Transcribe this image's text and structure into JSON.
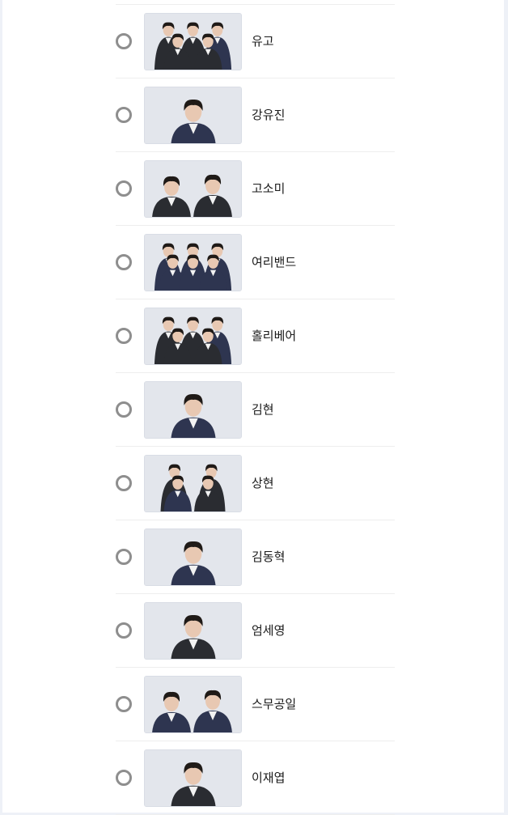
{
  "vote": {
    "options": [
      {
        "name": "유고",
        "photo": "group-photo-icon",
        "people": 5
      },
      {
        "name": "강유진",
        "photo": "person-photo-icon",
        "people": 1
      },
      {
        "name": "고소미",
        "photo": "duo-photo-icon",
        "people": 2
      },
      {
        "name": "여리밴드",
        "photo": "group-photo-icon",
        "people": 6
      },
      {
        "name": "홀리베어",
        "photo": "group-photo-icon",
        "people": 5
      },
      {
        "name": "김현",
        "photo": "person-photo-icon",
        "people": 1
      },
      {
        "name": "상현",
        "photo": "group-photo-icon",
        "people": 4
      },
      {
        "name": "김동혁",
        "photo": "person-photo-icon",
        "people": 1
      },
      {
        "name": "엄세영",
        "photo": "person-photo-icon",
        "people": 1
      },
      {
        "name": "스무공일",
        "photo": "duo-photo-icon",
        "people": 2
      },
      {
        "name": "이재엽",
        "photo": "person-photo-icon",
        "people": 1
      }
    ],
    "colors": {
      "radio_border": "#8e8e8e",
      "photo_background": "#e3e6ec",
      "jacket_dark": "#2a2c31",
      "jacket_navy": "#2e3550",
      "hair": "#1f1a17",
      "skin": "#e8c8b2"
    }
  }
}
